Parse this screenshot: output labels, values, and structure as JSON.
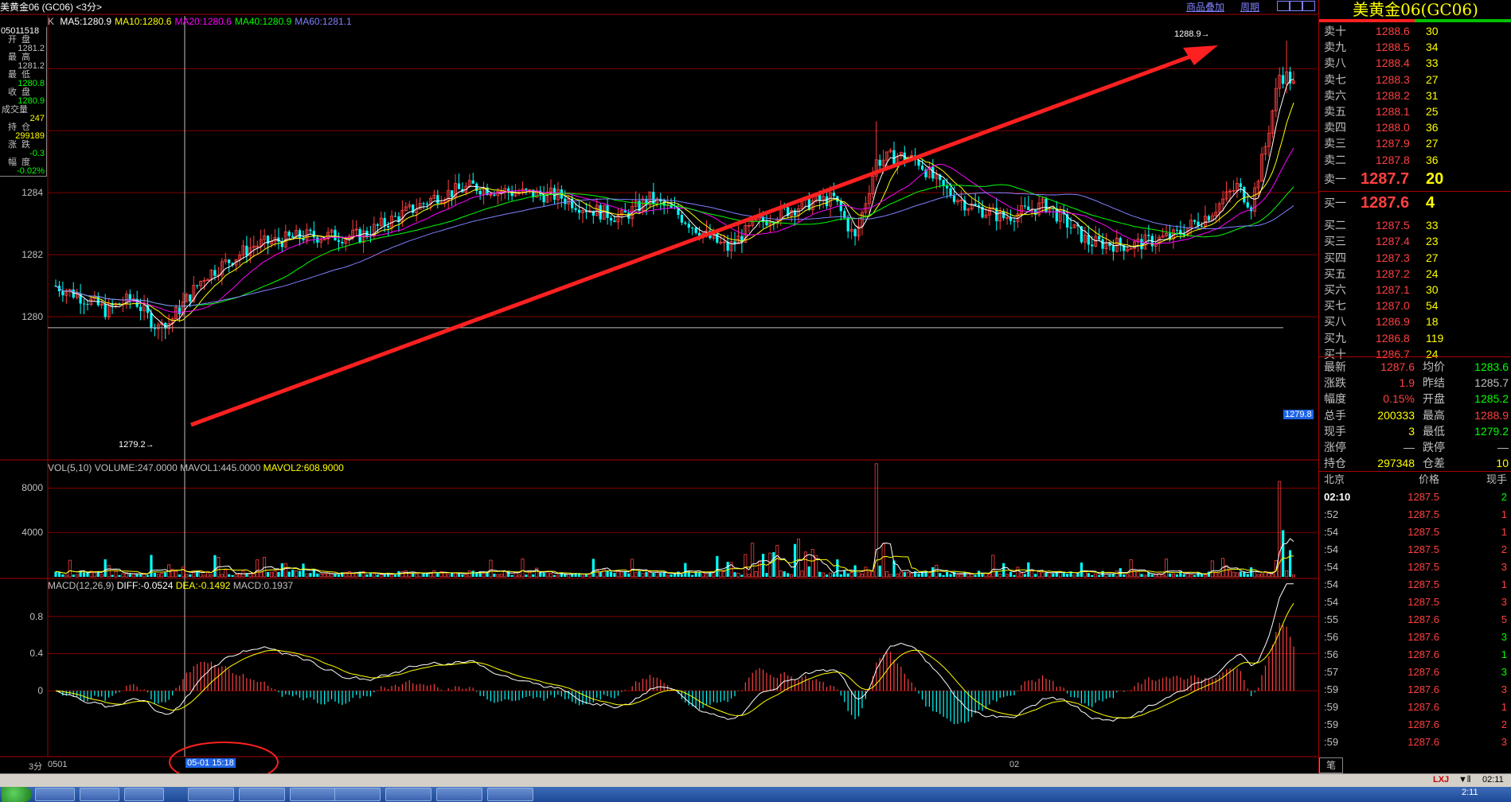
{
  "window_title": "美黄金06 (GC06) <3分>",
  "toolbar": {
    "overlay_label": "商品叠加",
    "period_label": "周期"
  },
  "ma_legend": {
    "prefix": "K",
    "items": [
      {
        "label": "MA5:1280.9",
        "color": "#ffffff"
      },
      {
        "label": "MA10:1280.6",
        "color": "#ffff00"
      },
      {
        "label": "MA20:1280.6",
        "color": "#ff00ff"
      },
      {
        "label": "MA40:1280.9",
        "color": "#00ff00"
      },
      {
        "label": "MA60:1281.1",
        "color": "#8080ff"
      }
    ]
  },
  "info_panel": {
    "time": "05011518",
    "rows": [
      {
        "label": "开盘",
        "value": "1281.2",
        "color": "#c0c0c0"
      },
      {
        "label": "最高",
        "value": "1281.2",
        "color": "#c0c0c0"
      },
      {
        "label": "最低",
        "value": "1280.8",
        "color": "#00ff00"
      },
      {
        "label": "收盘",
        "value": "1280.9",
        "color": "#00ff00"
      },
      {
        "label": "成交量",
        "value": "247",
        "color": "#ffff00"
      },
      {
        "label": "持仓",
        "value": "299189",
        "color": "#ffff00"
      },
      {
        "label": "涨跌",
        "value": "-0.3",
        "color": "#00ff00"
      },
      {
        "label": "幅度",
        "value": "-0.02%",
        "color": "#00ff00"
      }
    ]
  },
  "price_axis": {
    "ticks": [
      "1284",
      "1282",
      "1280"
    ],
    "min": 1278.0,
    "max": 1289.7
  },
  "annotations": {
    "high_label": "1288.9",
    "low_label": "1279.2",
    "crosshair_price": "1279.8"
  },
  "volume_panel": {
    "legend": "VOL(5,10) VOLUME:247.0000 MAVOL1:445.0000",
    "legend2": "MAVOL2:608.9000",
    "ticks": [
      "8000",
      "4000"
    ]
  },
  "macd_panel": {
    "legend_prefix": "MACD(12,26,9)",
    "diff": "DIFF:-0.0524",
    "dea": "DEA:-0.1492",
    "macd": "MACD:0.1937",
    "ticks": [
      "0.8",
      "0.4",
      "0"
    ]
  },
  "time_axis": {
    "period": "3分",
    "start": "0501",
    "cursor_time": "05-01 15:18",
    "mid": "02"
  },
  "right_panel": {
    "title": "美黄金06(GC06)",
    "asks": [
      {
        "label": "卖十",
        "price": "1288.6",
        "vol": "30"
      },
      {
        "label": "卖九",
        "price": "1288.5",
        "vol": "34"
      },
      {
        "label": "卖八",
        "price": "1288.4",
        "vol": "33"
      },
      {
        "label": "卖七",
        "price": "1288.3",
        "vol": "27"
      },
      {
        "label": "卖六",
        "price": "1288.2",
        "vol": "31"
      },
      {
        "label": "卖五",
        "price": "1288.1",
        "vol": "25"
      },
      {
        "label": "卖四",
        "price": "1288.0",
        "vol": "36"
      },
      {
        "label": "卖三",
        "price": "1287.9",
        "vol": "27"
      },
      {
        "label": "卖二",
        "price": "1287.8",
        "vol": "36"
      },
      {
        "label": "卖一",
        "price": "1287.7",
        "vol": "20"
      }
    ],
    "bids": [
      {
        "label": "买一",
        "price": "1287.6",
        "vol": "4"
      },
      {
        "label": "买二",
        "price": "1287.5",
        "vol": "33"
      },
      {
        "label": "买三",
        "price": "1287.4",
        "vol": "23"
      },
      {
        "label": "买四",
        "price": "1287.3",
        "vol": "27"
      },
      {
        "label": "买五",
        "price": "1287.2",
        "vol": "24"
      },
      {
        "label": "买六",
        "price": "1287.1",
        "vol": "30"
      },
      {
        "label": "买七",
        "price": "1287.0",
        "vol": "54"
      },
      {
        "label": "买八",
        "price": "1286.9",
        "vol": "18"
      },
      {
        "label": "买九",
        "price": "1286.8",
        "vol": "119"
      },
      {
        "label": "买十",
        "price": "1286.7",
        "vol": "24"
      }
    ],
    "stats": [
      {
        "l1": "最新",
        "v1": "1287.6",
        "c1": "#ff4040",
        "l2": "均价",
        "v2": "1283.6",
        "c2": "#00ff00"
      },
      {
        "l1": "涨跌",
        "v1": "1.9",
        "c1": "#ff4040",
        "l2": "昨结",
        "v2": "1285.7",
        "c2": "#c0c0c0"
      },
      {
        "l1": "幅度",
        "v1": "0.15%",
        "c1": "#ff4040",
        "l2": "开盘",
        "v2": "1285.2",
        "c2": "#00ff00"
      },
      {
        "l1": "总手",
        "v1": "200333",
        "c1": "#ffff00",
        "l2": "最高",
        "v2": "1288.9",
        "c2": "#ff4040"
      },
      {
        "l1": "现手",
        "v1": "3",
        "c1": "#ffff00",
        "l2": "最低",
        "v2": "1279.2",
        "c2": "#00ff00"
      },
      {
        "l1": "涨停",
        "v1": "—",
        "c1": "#c0c0c0",
        "l2": "跌停",
        "v2": "—",
        "c2": "#c0c0c0"
      },
      {
        "l1": "持仓",
        "v1": "297348",
        "c1": "#ffff00",
        "l2": "仓差",
        "v2": "10",
        "c2": "#ffff00"
      }
    ],
    "ticks_header": {
      "time": "北京",
      "price": "价格",
      "vol": "现手"
    },
    "ticks": [
      {
        "t": "02:10",
        "p": "1287.5",
        "v": "2",
        "vc": "#00ff00"
      },
      {
        "t": ":52",
        "p": "1287.5",
        "v": "1",
        "vc": "#ff4040"
      },
      {
        "t": ":54",
        "p": "1287.5",
        "v": "1",
        "vc": "#ff4040"
      },
      {
        "t": ":54",
        "p": "1287.5",
        "v": "2",
        "vc": "#ff4040"
      },
      {
        "t": ":54",
        "p": "1287.5",
        "v": "3",
        "vc": "#ff4040"
      },
      {
        "t": ":54",
        "p": "1287.5",
        "v": "1",
        "vc": "#ff4040"
      },
      {
        "t": ":54",
        "p": "1287.5",
        "v": "3",
        "vc": "#ff4040"
      },
      {
        "t": ":55",
        "p": "1287.6",
        "v": "5",
        "vc": "#ff4040"
      },
      {
        "t": ":56",
        "p": "1287.6",
        "v": "3",
        "vc": "#00ff00"
      },
      {
        "t": ":56",
        "p": "1287.6",
        "v": "1",
        "vc": "#00ff00"
      },
      {
        "t": ":57",
        "p": "1287.6",
        "v": "3",
        "vc": "#00ff00"
      },
      {
        "t": ":59",
        "p": "1287.6",
        "v": "3",
        "vc": "#ff4040"
      },
      {
        "t": ":59",
        "p": "1287.6",
        "v": "1",
        "vc": "#ff4040"
      },
      {
        "t": ":59",
        "p": "1287.6",
        "v": "2",
        "vc": "#ff4040"
      },
      {
        "t": ":59",
        "p": "1287.6",
        "v": "3",
        "vc": "#ff4040"
      }
    ],
    "bottom_tab": "笔"
  },
  "status_bar": {
    "right_text": "LXJ",
    "time": "02:11"
  },
  "taskbar": {
    "clock": "2:11"
  },
  "colors": {
    "up": "#ff4040",
    "down": "#00ffff",
    "grid": "#800000",
    "accent": "#ff0000"
  },
  "chart_data": {
    "type": "candlestick",
    "price_key_points": [
      {
        "label": "start",
        "price": 1281.0
      },
      {
        "label": "low",
        "price": 1279.2
      },
      {
        "label": "mid_peak",
        "price": 1284.2
      },
      {
        "label": "spike",
        "price": 1286.3
      },
      {
        "label": "dip",
        "price": 1282.1
      },
      {
        "label": "high",
        "price": 1288.9
      },
      {
        "label": "last",
        "price": 1287.6
      }
    ]
  }
}
